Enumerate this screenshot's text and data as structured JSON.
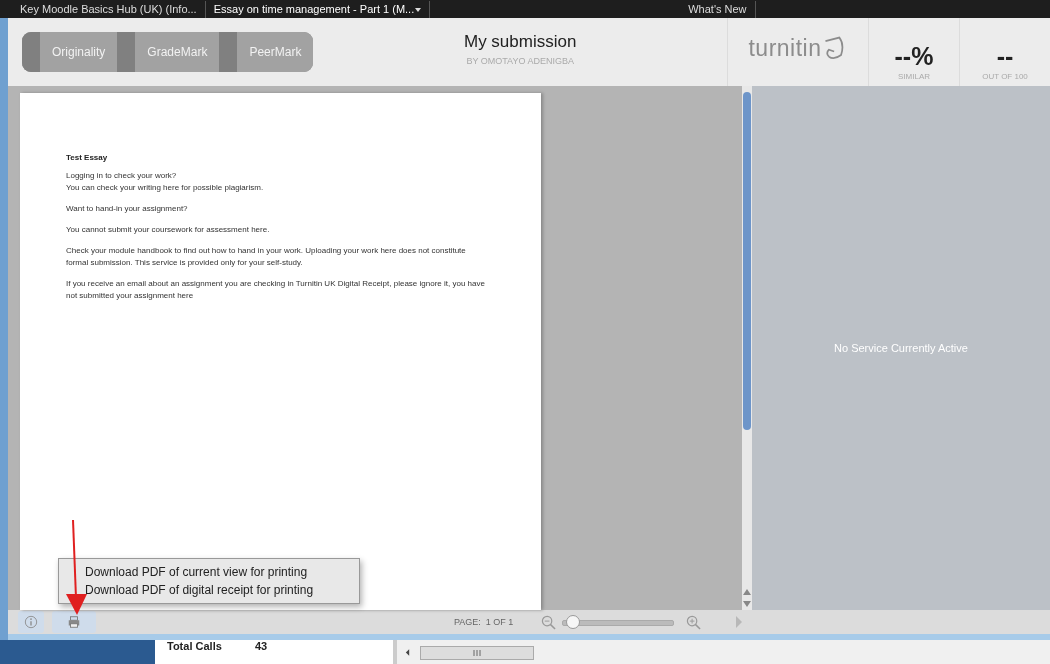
{
  "browser_tabs": [
    {
      "label": "Key Moodle Basics Hub (UK) (Info...",
      "selected": false
    },
    {
      "label": "Essay on time management - Part 1 (M...",
      "selected": true,
      "caret": true
    },
    {
      "label": "What's New",
      "selected": false
    }
  ],
  "modes": [
    {
      "label": "Originality",
      "selected": false
    },
    {
      "label": "GradeMark",
      "selected": false
    },
    {
      "label": "PeerMark",
      "selected": false
    }
  ],
  "submission": {
    "title": "My submission",
    "author": "BY OMOTAYO ADENIGBA"
  },
  "logo": "turnitin",
  "scores": [
    {
      "value": "--%",
      "caption": "SIMILAR"
    },
    {
      "value": "--",
      "caption": "OUT OF 100"
    }
  ],
  "document": {
    "heading": "Test Essay",
    "paragraphs": [
      "Logging in to check your work?\nYou can check your writing here for possible plagiarism.",
      "Want to hand-in your assignment?",
      "You cannot submit your coursework for assessment here.",
      "Check your module handbook to find out how to hand in your work. Uploading your work here does not constitute formal submission. This service is provided only for your self-study.",
      "If you receive an email about an assignment you are checking in Turnitin UK Digital Receipt, please ignore it, you have not submitted your assignment here"
    ]
  },
  "side_panel": {
    "message": "No Service Currently Active"
  },
  "print_menu": [
    "Download PDF of current view for printing",
    "Download PDF of digital receipt for printing"
  ],
  "toolbar": {
    "page_label": "PAGE:",
    "page": "1 OF 1",
    "zoom": {
      "level": 0.03
    }
  },
  "background_panel": {
    "label": "Total Calls",
    "value": "43"
  }
}
